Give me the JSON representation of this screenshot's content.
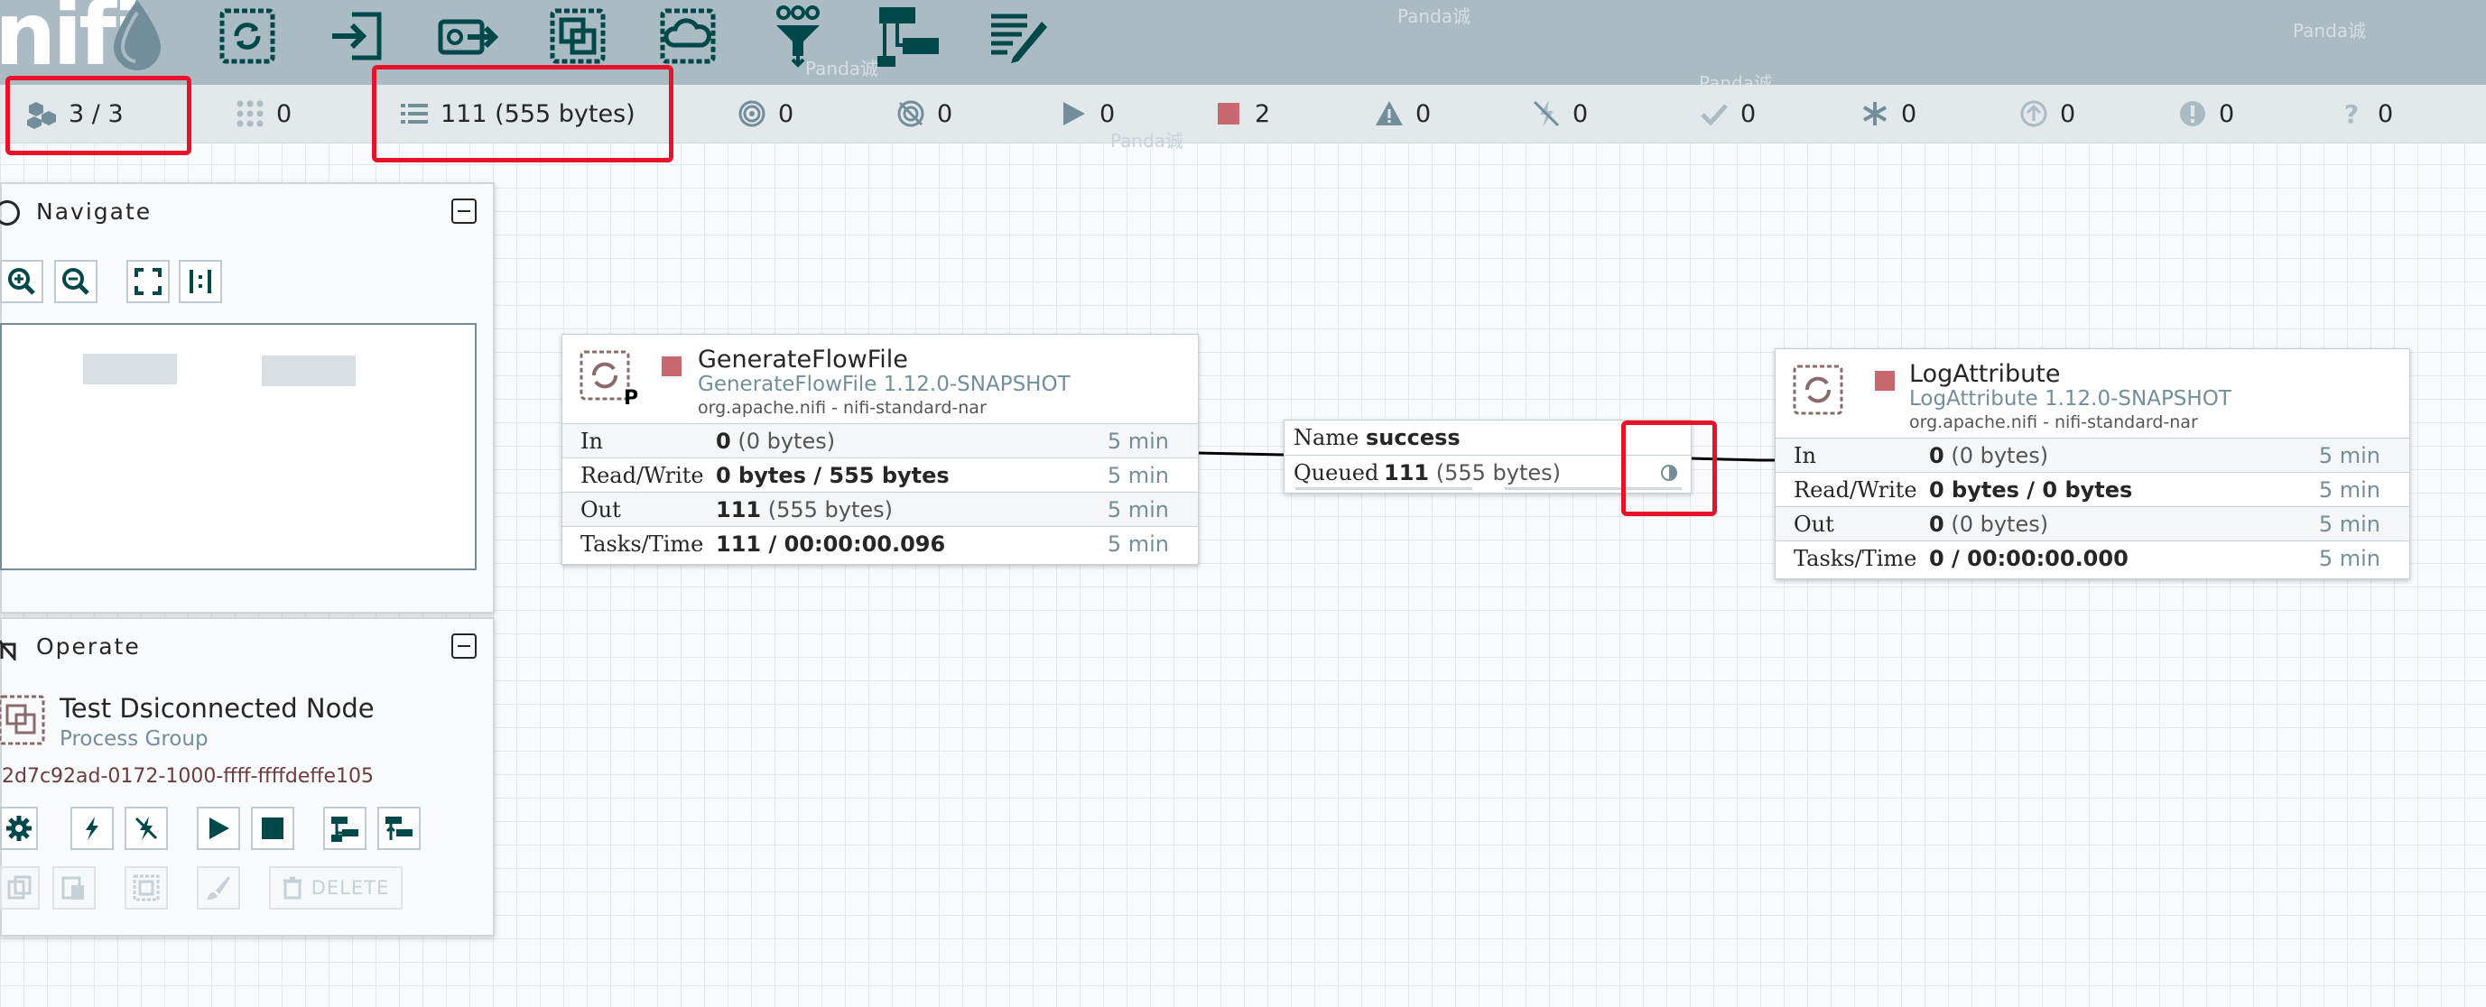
{
  "colors": {
    "toolbar_bg": "#aabbc3",
    "status_bg": "#e3e8eb",
    "icon_dark": "#004849",
    "stopped": "#c8696f",
    "highlight": "#e8132a",
    "muted_text": "#728e9b"
  },
  "toolbar": {
    "logo": "nifi",
    "tools": [
      "processor-icon",
      "input-port-icon",
      "output-port-icon",
      "process-group-icon",
      "remote-process-group-icon",
      "funnel-icon",
      "template-icon",
      "label-icon"
    ],
    "watermarks": [
      "Panda诚",
      "Panda诚",
      "Panda诚",
      "Panda诚",
      "Panda诚"
    ]
  },
  "status": {
    "cluster_nodes": "3 / 3",
    "active_threads": "0",
    "queued": "111 (555 bytes)",
    "transmitting": "0",
    "not_transmitting": "0",
    "running": "0",
    "stopped": "2",
    "invalid": "0",
    "disabled": "0",
    "up_to_date": "0",
    "locally_modified": "0",
    "stale": "0",
    "locally_modified_stale": "0",
    "sync_failure": "0"
  },
  "navigate": {
    "title": "Navigate"
  },
  "operate": {
    "title": "Operate",
    "selection_name": "Test Dsiconnected Node",
    "selection_type": "Process Group",
    "selection_id": "2d7c92ad-0172-1000-ffff-ffffdeffe105",
    "delete_label": "DELETE"
  },
  "generate": {
    "name": "GenerateFlowFile",
    "type": "GenerateFlowFile 1.12.0-SNAPSHOT",
    "bundle": "org.apache.nifi - nifi-standard-nar",
    "badge": "P",
    "rows": [
      {
        "label": "In",
        "value": "0",
        "sub": " (0 bytes)",
        "time": "5 min"
      },
      {
        "label": "Read/Write",
        "value": "0 bytes / 555 bytes",
        "sub": "",
        "time": "5 min"
      },
      {
        "label": "Out",
        "value": "111",
        "sub": " (555 bytes)",
        "time": "5 min"
      },
      {
        "label": "Tasks/Time",
        "value": "111 / 00:00:00.096",
        "sub": "",
        "time": "5 min"
      }
    ]
  },
  "logattr": {
    "name": "LogAttribute",
    "type": "LogAttribute 1.12.0-SNAPSHOT",
    "bundle": "org.apache.nifi - nifi-standard-nar",
    "rows": [
      {
        "label": "In",
        "value": "0",
        "sub": " (0 bytes)",
        "time": "5 min"
      },
      {
        "label": "Read/Write",
        "value": "0 bytes / 0 bytes",
        "sub": "",
        "time": "5 min"
      },
      {
        "label": "Out",
        "value": "0",
        "sub": " (0 bytes)",
        "time": "5 min"
      },
      {
        "label": "Tasks/Time",
        "value": "0 / 00:00:00.000",
        "sub": "",
        "time": "5 min"
      }
    ]
  },
  "connection": {
    "name_label": "Name",
    "name": "success",
    "queued_label": "Queued",
    "queued_count": "111",
    "queued_size": " (555 bytes)"
  }
}
